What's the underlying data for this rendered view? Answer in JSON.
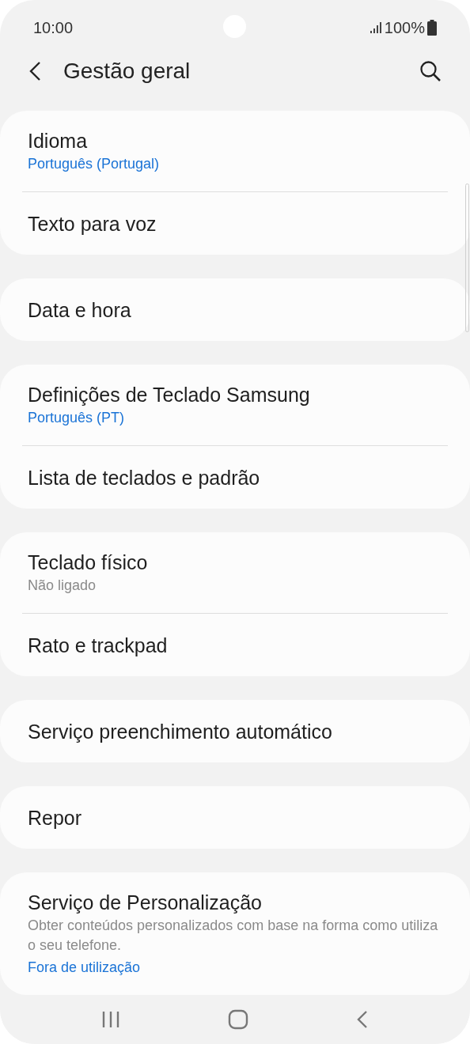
{
  "status_bar": {
    "time": "10:00",
    "battery": "100%"
  },
  "header": {
    "title": "Gestão geral"
  },
  "groups": [
    {
      "items": [
        {
          "title": "Idioma",
          "subtitle": {
            "text": "Português (Portugal)",
            "kind": "accent"
          }
        },
        {
          "title": "Texto para voz"
        }
      ]
    },
    {
      "items": [
        {
          "title": "Data e hora"
        }
      ]
    },
    {
      "items": [
        {
          "title": "Definições de Teclado Samsung",
          "subtitle": {
            "text": "Português (PT)",
            "kind": "accent"
          }
        },
        {
          "title": "Lista de teclados e padrão"
        }
      ]
    },
    {
      "items": [
        {
          "title": "Teclado físico",
          "subtitle": {
            "text": "Não ligado",
            "kind": "muted"
          }
        },
        {
          "title": "Rato e trackpad"
        }
      ]
    },
    {
      "items": [
        {
          "title": "Serviço preenchimento automático"
        }
      ]
    },
    {
      "items": [
        {
          "title": "Repor"
        }
      ]
    },
    {
      "items": [
        {
          "title": "Serviço de Personalização",
          "subtitle": {
            "text": "Obter conteúdos personalizados com base na forma como utiliza o seu telefone.",
            "kind": "muted"
          },
          "link": "Fora de utilização"
        }
      ]
    }
  ]
}
